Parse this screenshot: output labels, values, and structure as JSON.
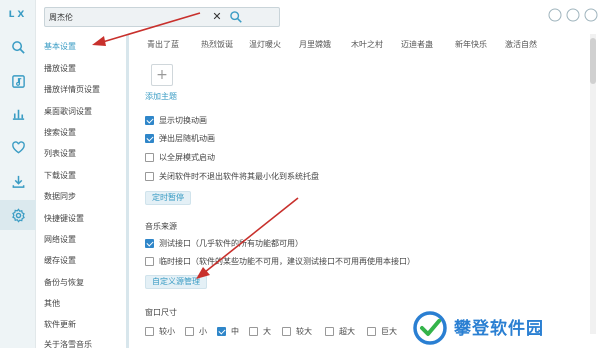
{
  "app": {
    "logo": "LX"
  },
  "search": {
    "value": "周杰伦",
    "clear_glyph": "✕"
  },
  "nav": {
    "items": [
      {
        "label": "基本设置",
        "active": true
      },
      {
        "label": "播放设置"
      },
      {
        "label": "播放详情页设置"
      },
      {
        "label": "桌面歌词设置"
      },
      {
        "label": "搜索设置"
      },
      {
        "label": "列表设置"
      },
      {
        "label": "下载设置"
      },
      {
        "label": "数据同步"
      },
      {
        "label": "快捷键设置"
      },
      {
        "label": "网络设置"
      },
      {
        "label": "缓存设置"
      },
      {
        "label": "备份与恢复"
      },
      {
        "label": "其他"
      },
      {
        "label": "软件更新"
      },
      {
        "label": "关于洛雪音乐"
      }
    ]
  },
  "content": {
    "themes": [
      "青出了蓝",
      "热烈饭诞",
      "温灯暖火",
      "月里嫦娥",
      "木叶之村",
      "迈迪者蛊",
      "新年快乐",
      "激活自然"
    ],
    "add_theme": "添加主题",
    "options": [
      {
        "label": "显示切换动画",
        "checked": true
      },
      {
        "label": "弹出层随机动画",
        "checked": true
      },
      {
        "label": "以全屏模式启动",
        "checked": false
      },
      {
        "label": "关闭软件时不退出软件将其最小化到系统托盘",
        "checked": false
      }
    ],
    "tray_button": "定时暂停",
    "music_source_title": "音乐来源",
    "sources": [
      {
        "label": "测试接口（几乎软件的所有功能都可用）",
        "checked": true
      },
      {
        "label": "临时接口（软件的某些功能不可用，建议测试接口不可用再使用本接口）",
        "checked": false
      }
    ],
    "source_button": "自定义源管理",
    "window_size_title": "窗口尺寸",
    "window_sizes": [
      {
        "label": "较小",
        "checked": false
      },
      {
        "label": "小",
        "checked": false
      },
      {
        "label": "中",
        "checked": true
      },
      {
        "label": "大",
        "checked": false
      },
      {
        "label": "较大",
        "checked": false
      },
      {
        "label": "超大",
        "checked": false
      },
      {
        "label": "巨大",
        "checked": false
      }
    ]
  },
  "watermark": {
    "text": "攀登软件园"
  },
  "colors": {
    "accent": "#3a9cc4",
    "check": "#2f86c9",
    "arrow": "#c8302c"
  },
  "icons": {
    "rail": [
      "search-icon",
      "song-list-icon",
      "leaderboard-icon",
      "heart-icon",
      "download-icon",
      "gear-icon"
    ],
    "window": [
      "minimize-icon",
      "maximize-icon",
      "close-icon"
    ]
  }
}
